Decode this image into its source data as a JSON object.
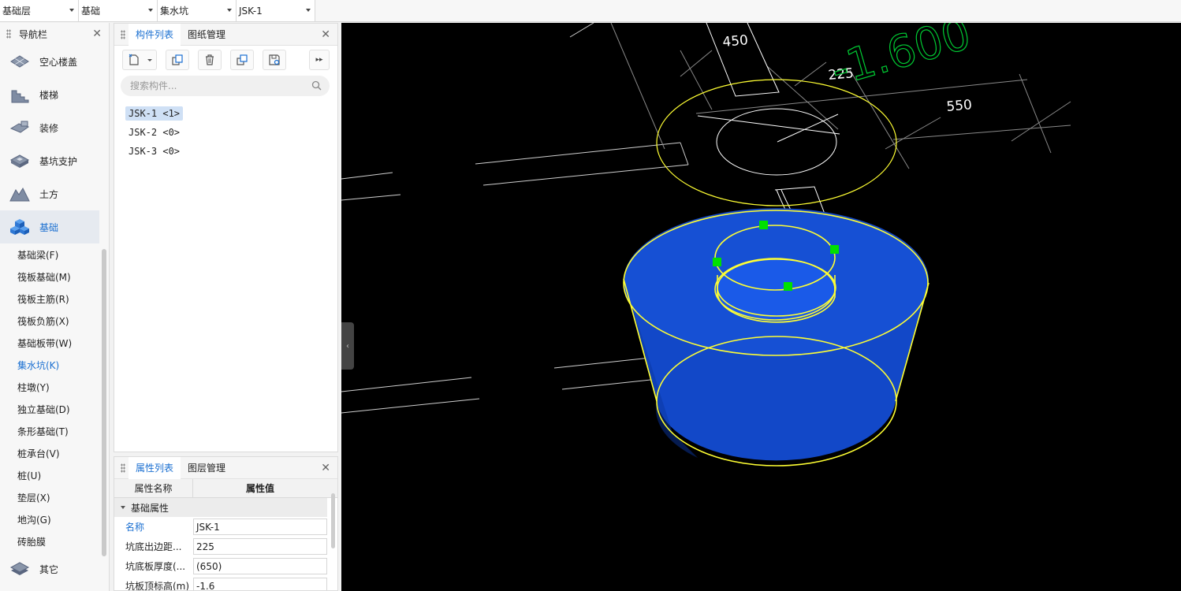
{
  "topbar": {
    "combos": [
      {
        "value": "基础层"
      },
      {
        "value": "基础"
      },
      {
        "value": "集水坑"
      },
      {
        "value": "JSK-1"
      }
    ]
  },
  "nav": {
    "title": "导航栏",
    "categories": [
      {
        "label": "空心楼盖",
        "icon": "hollow-slab-icon"
      },
      {
        "label": "楼梯",
        "icon": "stairs-icon"
      },
      {
        "label": "装修",
        "icon": "decoration-icon"
      },
      {
        "label": "基坑支护",
        "icon": "pit-support-icon"
      },
      {
        "label": "土方",
        "icon": "earthwork-icon"
      },
      {
        "label": "基础",
        "icon": "foundation-icon",
        "active": true
      }
    ],
    "sub_items": [
      "基础梁(F)",
      "筏板基础(M)",
      "筏板主筋(R)",
      "筏板负筋(X)",
      "基础板带(W)",
      "集水坑(K)",
      "柱墩(Y)",
      "独立基础(D)",
      "条形基础(T)",
      "桩承台(V)",
      "桩(U)",
      "垫层(X)",
      "地沟(G)",
      "砖胎膜"
    ],
    "active_sub": 5,
    "other": {
      "label": "其它",
      "icon": "layers-icon"
    }
  },
  "component_panel": {
    "tabs": [
      "构件列表",
      "图纸管理"
    ],
    "search_placeholder": "搜索构件...",
    "items": [
      "JSK-1 <1>",
      "JSK-2 <0>",
      "JSK-3 <0>"
    ],
    "selected": 0
  },
  "property_panel": {
    "tabs": [
      "属性列表",
      "图层管理"
    ],
    "columns": [
      "属性名称",
      "属性值"
    ],
    "group": "基础属性",
    "rows": [
      {
        "name": "名称",
        "value": "JSK-1"
      },
      {
        "name": "坑底出边距...",
        "value": "225"
      },
      {
        "name": "坑底板厚度(...",
        "value": "(650)"
      },
      {
        "name": "坑板顶标高(m)",
        "value": "-1.6"
      }
    ]
  },
  "viewport": {
    "dims": {
      "d450": "450",
      "d225": "225",
      "d550": "550",
      "elev": "-1.600"
    },
    "colors": {
      "fill": "#1248c8",
      "outline": "#ffff33",
      "grip": "#00e000",
      "dim": "#00cc33"
    }
  }
}
